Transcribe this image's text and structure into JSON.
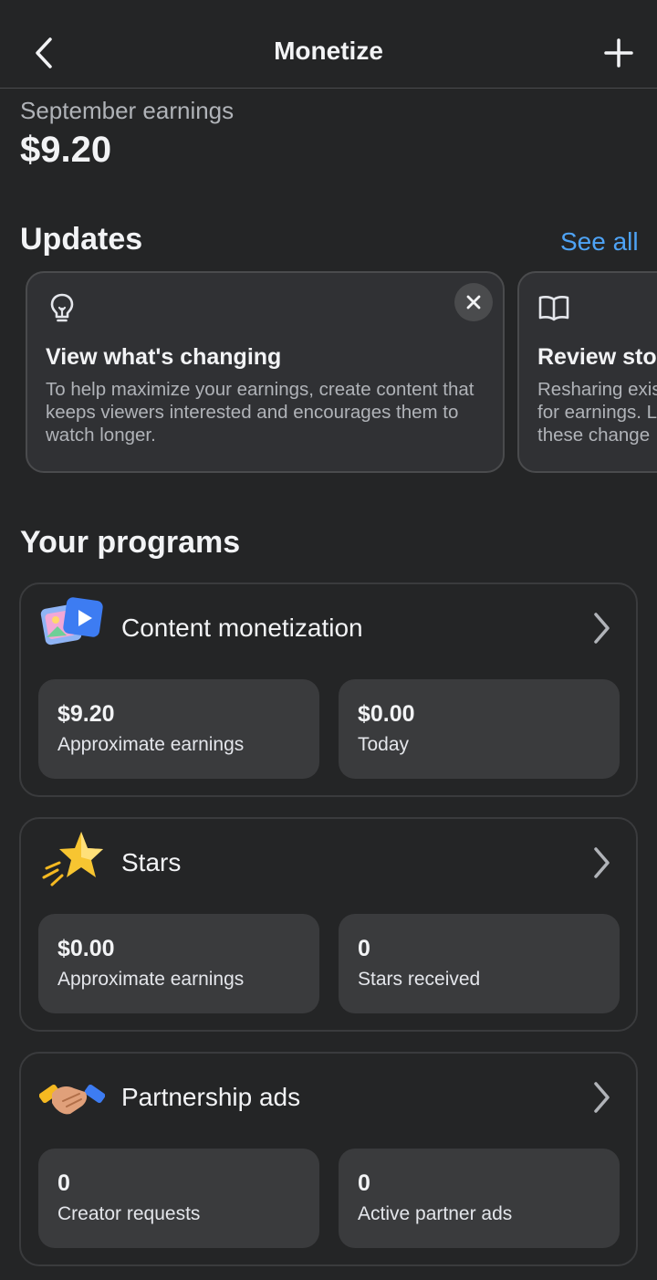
{
  "header": {
    "title": "Monetize",
    "back_icon": "chevron-left-icon",
    "add_icon": "plus-icon"
  },
  "earnings": {
    "label": "September earnings",
    "value": "$9.20"
  },
  "updates": {
    "title": "Updates",
    "see_all": "See all",
    "cards": [
      {
        "icon": "lightbulb-icon",
        "title": "View what's changing",
        "body": "To help maximize your earnings, create content that keeps viewers interested and encourages them to watch longer."
      },
      {
        "icon": "book-icon",
        "title": "Review stor",
        "body": "Resharing exis for earnings. L these change"
      }
    ]
  },
  "programs": {
    "title": "Your programs",
    "items": [
      {
        "name": "Content monetization",
        "icon": "media-play-icon",
        "stats": [
          {
            "value": "$9.20",
            "label": "Approximate earnings"
          },
          {
            "value": "$0.00",
            "label": "Today"
          }
        ]
      },
      {
        "name": "Stars",
        "icon": "star-icon",
        "stats": [
          {
            "value": "$0.00",
            "label": "Approximate earnings"
          },
          {
            "value": "0",
            "label": "Stars received"
          }
        ]
      },
      {
        "name": "Partnership ads",
        "icon": "handshake-icon",
        "stats": [
          {
            "value": "0",
            "label": "Creator requests"
          },
          {
            "value": "0",
            "label": "Active partner ads"
          }
        ]
      }
    ]
  },
  "colors": {
    "background": "#242526",
    "card": "#303134",
    "stat_tile": "#3a3b3d",
    "link": "#4ea3f5",
    "text_primary": "#f2f3f5",
    "text_secondary": "#b0b3b8"
  }
}
